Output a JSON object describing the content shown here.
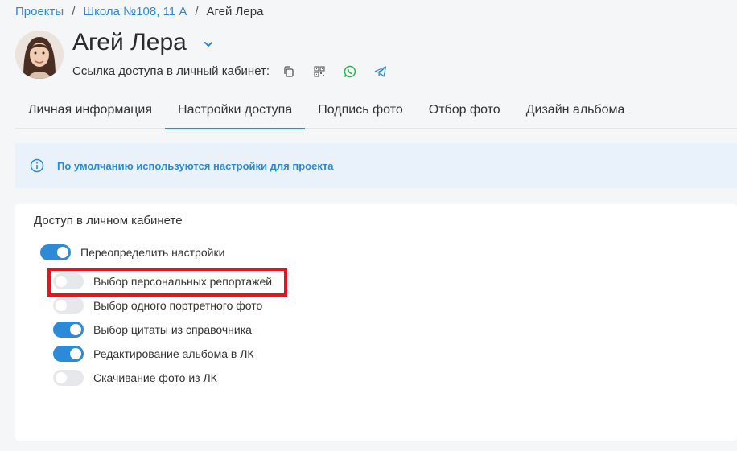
{
  "breadcrumb": {
    "items": [
      "Проекты",
      "Школа №108, 11 А"
    ],
    "current": "Агей Лера",
    "separator": "/"
  },
  "profile": {
    "name": "Агей Лера",
    "access_link_label": "Ссылка доступа в личный кабинет:",
    "share_icons": [
      "copy-icon",
      "qr-code-icon",
      "whatsapp-icon",
      "telegram-icon"
    ]
  },
  "tabs": [
    {
      "label": "Личная информация",
      "active": false
    },
    {
      "label": "Настройки доступа",
      "active": true
    },
    {
      "label": "Подпись фото",
      "active": false
    },
    {
      "label": "Отбор фото",
      "active": false
    },
    {
      "label": "Дизайн альбома",
      "active": false
    }
  ],
  "info_bar": {
    "text": "По умолчанию используются настройки для проекта"
  },
  "access_card": {
    "title": "Доступ в личном кабинете",
    "override": {
      "label": "Переопределить настройки",
      "enabled": true
    },
    "settings": [
      {
        "label": "Выбор персональных репортажей",
        "enabled": false,
        "highlighted": true
      },
      {
        "label": "Выбор одного портретного фото",
        "enabled": false
      },
      {
        "label": "Выбор цитаты из справочника",
        "enabled": true
      },
      {
        "label": "Редактирование альбома в ЛК",
        "enabled": true
      },
      {
        "label": "Скачивание фото из ЛК",
        "enabled": false
      }
    ]
  },
  "colors": {
    "accent": "#2d8ad6",
    "highlight": "#e8141b",
    "whatsapp": "#25b34a",
    "toggle_off": "#e6e8eb"
  }
}
